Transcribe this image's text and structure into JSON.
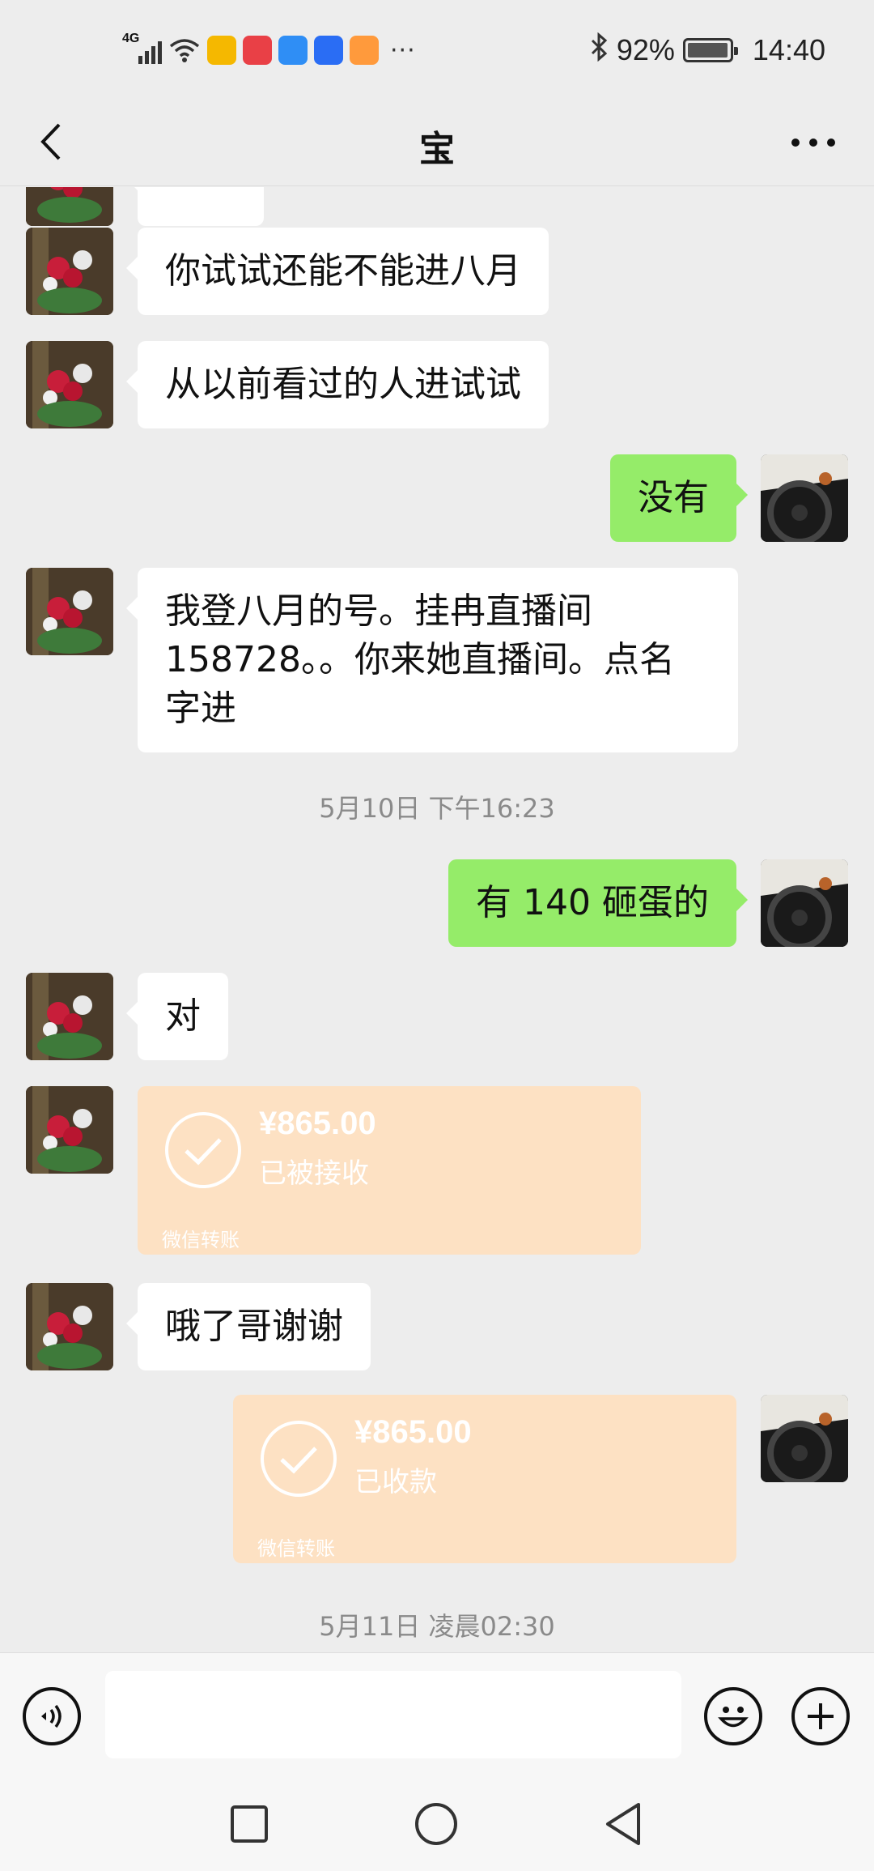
{
  "status_bar": {
    "network": "4G",
    "battery": "92%",
    "time": "14:40",
    "more": "···",
    "app_icons": [
      {
        "name": "weibo-icon",
        "color": "#f5b800"
      },
      {
        "name": "red-app-icon",
        "color": "#e94046"
      },
      {
        "name": "cloud-icon",
        "color": "#2f8ef5"
      },
      {
        "name": "bulb-icon",
        "color": "#2a6df4"
      },
      {
        "name": "taobao-icon",
        "color": "#ff9a3c"
      }
    ]
  },
  "header": {
    "title": "宝",
    "back_icon": "chevron-left-icon",
    "more_icon": "more-icon"
  },
  "messages": [
    {
      "from": "contact",
      "type": "text",
      "text": "你试试还能不能进八月"
    },
    {
      "from": "contact",
      "type": "text",
      "text": "从以前看过的人进试试"
    },
    {
      "from": "me",
      "type": "text",
      "text": "没有"
    },
    {
      "from": "contact",
      "type": "text",
      "lines": [
        "我登八月的号。挂冉直播间",
        "158728。。你来她直播间。点名",
        "字进"
      ]
    },
    {
      "type": "timestamp",
      "text": "5月10日 下午16:23"
    },
    {
      "from": "me",
      "type": "text",
      "text": "有 140 砸蛋的"
    },
    {
      "from": "contact",
      "type": "text",
      "text": "对"
    },
    {
      "from": "contact",
      "type": "transfer",
      "amount": "¥865.00",
      "status": "已被接收",
      "footer": "微信转账"
    },
    {
      "from": "contact",
      "type": "text",
      "text": "哦了哥谢谢"
    },
    {
      "from": "me",
      "type": "transfer",
      "amount": "¥865.00",
      "status": "已收款",
      "footer": "微信转账"
    },
    {
      "type": "timestamp",
      "text": "5月11日 凌晨02:30"
    }
  ],
  "input_bar": {
    "voice_icon": "voice-icon",
    "emoji_icon": "emoji-icon",
    "plus_icon": "plus-icon",
    "input_value": ""
  },
  "system_nav": {
    "recents_icon": "square-icon",
    "home_icon": "circle-icon",
    "back_icon": "triangle-back-icon"
  },
  "colors": {
    "background": "#ededed",
    "my_bubble": "#95ec69",
    "their_bubble": "#ffffff",
    "transfer": "#fde1c3",
    "timestamp": "#8a8a8a"
  }
}
